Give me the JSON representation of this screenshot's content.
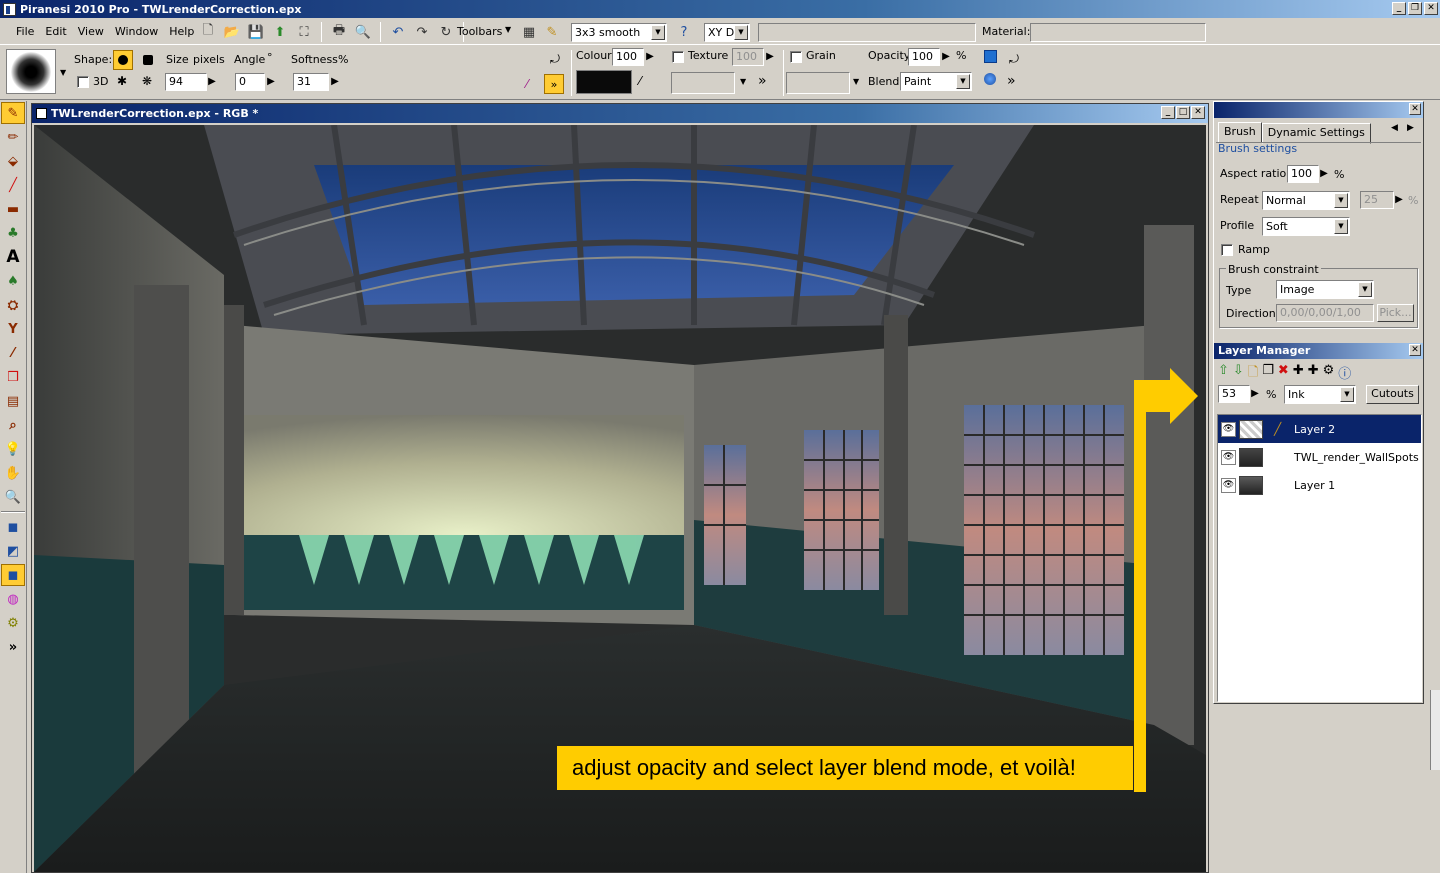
{
  "app": {
    "title": "Piranesi 2010 Pro - TWLrenderCorrection.epx"
  },
  "menu": [
    "File",
    "Edit",
    "View",
    "Window",
    "Help"
  ],
  "toolbar": {
    "toolbars_label": "Toolbars",
    "smooth_value": "3x3 smooth",
    "xy_value": "XY D",
    "material_label": "Material:"
  },
  "brushbar": {
    "shape_label": "Shape:",
    "three_d_label": "3D",
    "size_label": "Size",
    "pixels_label": "pixels",
    "size_value": "94",
    "angle_label": "Angle",
    "angle_unit": "°",
    "angle_value": "0",
    "softness_label": "Softness",
    "softness_unit": "%",
    "softness_value": "31",
    "colour_label": "Colour",
    "colour_value": "100",
    "texture_label": "Texture",
    "texture_value": "100",
    "grain_label": "Grain",
    "opacity_label": "Opacity",
    "opacity_value": "100",
    "opacity_unit": "%",
    "blend_label": "Blend",
    "blend_value": "Paint",
    "more_glyph": "»",
    "colour_hex": "#0a0a0a"
  },
  "document": {
    "title": "TWLrenderCorrection.epx - RGB *"
  },
  "brush_panel": {
    "tabs": [
      "Brush",
      "Dynamic Settings"
    ],
    "settings_link": "Brush settings",
    "aspect_label": "Aspect ratio",
    "aspect_value": "100",
    "aspect_unit": "%",
    "repeat_label": "Repeat",
    "repeat_value": "Normal",
    "repeat_num": "25",
    "repeat_unit": "%",
    "profile_label": "Profile",
    "profile_value": "Soft",
    "ramp_label": "Ramp",
    "constraint_label": "Brush constraint",
    "type_label": "Type",
    "type_value": "Image",
    "direction_label": "Direction",
    "direction_value": "0,00/0,00/1,00",
    "pick_label": "Pick..."
  },
  "layer_manager": {
    "title": "Layer Manager",
    "opacity_value": "53",
    "opacity_unit": "%",
    "blend_value": "Ink",
    "cutouts_label": "Cutouts",
    "layers": [
      {
        "name": "Layer 2"
      },
      {
        "name": "TWL_render_WallSpots"
      },
      {
        "name": "Layer 1"
      }
    ]
  },
  "callout": {
    "text": "adjust opacity and select layer blend mode, et voilà!",
    "color": "#ffcc00"
  }
}
